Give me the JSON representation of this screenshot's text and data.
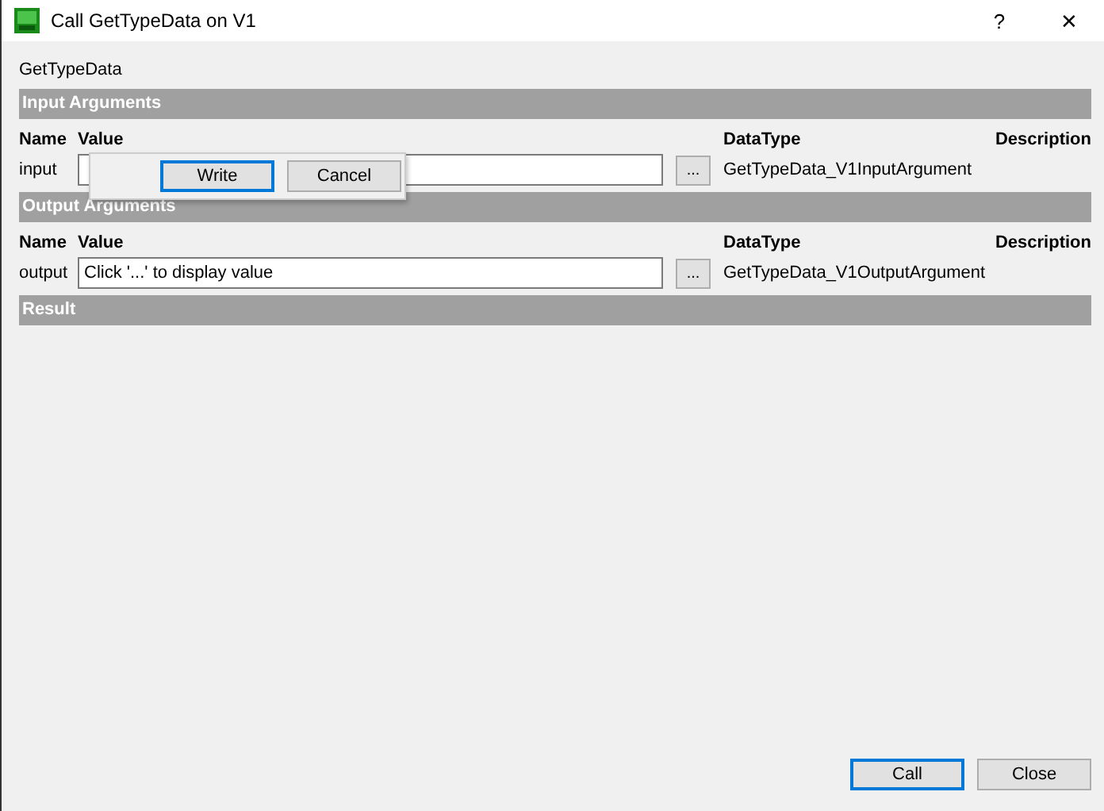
{
  "window": {
    "title": "Call GetTypeData on V1",
    "help": "?",
    "close": "✕"
  },
  "method": "GetTypeData",
  "sections": [
    {
      "kind": "arguments",
      "title": "Input Arguments",
      "columns": [
        "Name",
        "Value",
        "DataType",
        "Description"
      ],
      "rows": [
        {
          "name": "input",
          "browse": "...",
          "datatype": "GetTypeData_V1InputArgument"
        }
      ]
    },
    {
      "kind": "arguments",
      "title": "Output Arguments",
      "columns": [
        "Name",
        "Value",
        "DataType",
        "Description"
      ],
      "rows": [
        {
          "name": "output",
          "value": "Click '...' to display value",
          "browse": "...",
          "datatype": "GetTypeData_V1OutputArgument"
        }
      ]
    },
    {
      "kind": "result",
      "title": "Result"
    }
  ],
  "popup": {
    "buttons": [
      {
        "label": "Write",
        "selected": true
      },
      {
        "label": "Cancel",
        "selected": false
      }
    ]
  },
  "buttons": [
    {
      "label": "Call",
      "selected": true
    },
    {
      "label": "Close",
      "selected": false
    }
  ]
}
